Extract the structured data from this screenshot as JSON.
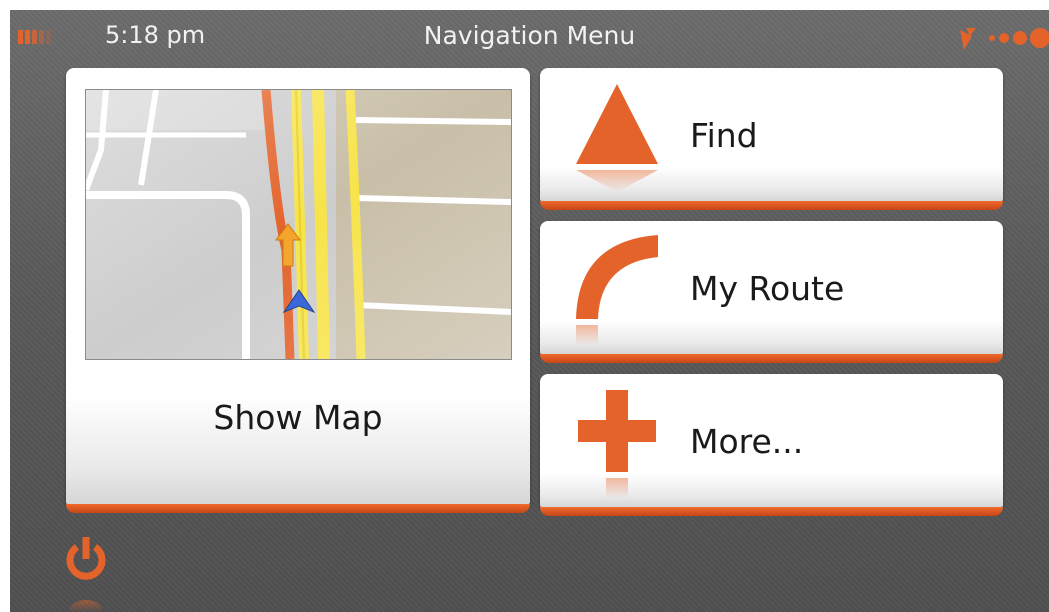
{
  "status_bar": {
    "time": "5:18 pm",
    "title": "Navigation Menu",
    "battery_icon": "battery-icon",
    "gps_icon": "gps-satellite-icon"
  },
  "menu": {
    "show_map_label": "Show Map",
    "find_label": "Find",
    "my_route_label": "My Route",
    "more_label": "More..."
  },
  "icons": {
    "find": "arrow-up-icon",
    "route": "route-curve-icon",
    "more": "plus-icon",
    "power": "power-icon"
  },
  "colors": {
    "accent": "#e4632b",
    "tile_background": "#ffffff",
    "screen_background": "#5f5f5f",
    "route_line": "#e4632b",
    "road_yellow": "#f7e44a",
    "position_marker": "#2a5bd7"
  }
}
